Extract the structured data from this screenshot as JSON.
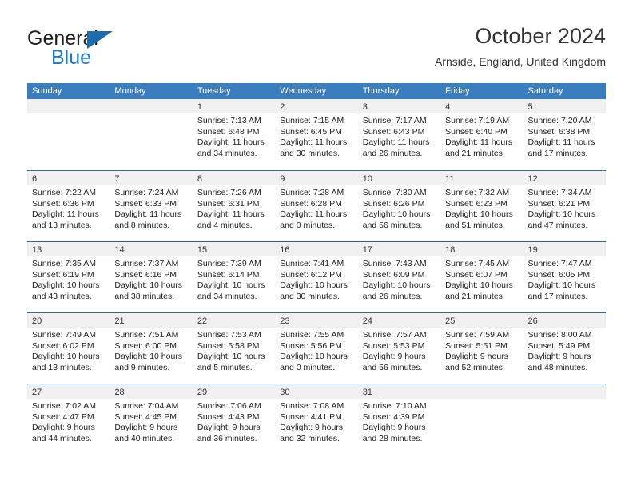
{
  "brand": {
    "name_top": "General",
    "name_bottom": "Blue",
    "accent_color": "#1b7cc4",
    "triangle_color": "#1b6cb0"
  },
  "header": {
    "title": "October 2024",
    "subtitle": "Arnside, England, United Kingdom"
  },
  "theme": {
    "header_row_bg": "#3b7ec0",
    "row_divider": "#2f6ca8",
    "day_band_bg": "#f0f0f0"
  },
  "weekdays": [
    "Sunday",
    "Monday",
    "Tuesday",
    "Wednesday",
    "Thursday",
    "Friday",
    "Saturday"
  ],
  "weeks": [
    [
      {
        "day": "",
        "sunrise": "",
        "sunset": "",
        "daylight1": "",
        "daylight2": ""
      },
      {
        "day": "",
        "sunrise": "",
        "sunset": "",
        "daylight1": "",
        "daylight2": ""
      },
      {
        "day": "1",
        "sunrise": "Sunrise: 7:13 AM",
        "sunset": "Sunset: 6:48 PM",
        "daylight1": "Daylight: 11 hours",
        "daylight2": "and 34 minutes."
      },
      {
        "day": "2",
        "sunrise": "Sunrise: 7:15 AM",
        "sunset": "Sunset: 6:45 PM",
        "daylight1": "Daylight: 11 hours",
        "daylight2": "and 30 minutes."
      },
      {
        "day": "3",
        "sunrise": "Sunrise: 7:17 AM",
        "sunset": "Sunset: 6:43 PM",
        "daylight1": "Daylight: 11 hours",
        "daylight2": "and 26 minutes."
      },
      {
        "day": "4",
        "sunrise": "Sunrise: 7:19 AM",
        "sunset": "Sunset: 6:40 PM",
        "daylight1": "Daylight: 11 hours",
        "daylight2": "and 21 minutes."
      },
      {
        "day": "5",
        "sunrise": "Sunrise: 7:20 AM",
        "sunset": "Sunset: 6:38 PM",
        "daylight1": "Daylight: 11 hours",
        "daylight2": "and 17 minutes."
      }
    ],
    [
      {
        "day": "6",
        "sunrise": "Sunrise: 7:22 AM",
        "sunset": "Sunset: 6:36 PM",
        "daylight1": "Daylight: 11 hours",
        "daylight2": "and 13 minutes."
      },
      {
        "day": "7",
        "sunrise": "Sunrise: 7:24 AM",
        "sunset": "Sunset: 6:33 PM",
        "daylight1": "Daylight: 11 hours",
        "daylight2": "and 8 minutes."
      },
      {
        "day": "8",
        "sunrise": "Sunrise: 7:26 AM",
        "sunset": "Sunset: 6:31 PM",
        "daylight1": "Daylight: 11 hours",
        "daylight2": "and 4 minutes."
      },
      {
        "day": "9",
        "sunrise": "Sunrise: 7:28 AM",
        "sunset": "Sunset: 6:28 PM",
        "daylight1": "Daylight: 11 hours",
        "daylight2": "and 0 minutes."
      },
      {
        "day": "10",
        "sunrise": "Sunrise: 7:30 AM",
        "sunset": "Sunset: 6:26 PM",
        "daylight1": "Daylight: 10 hours",
        "daylight2": "and 56 minutes."
      },
      {
        "day": "11",
        "sunrise": "Sunrise: 7:32 AM",
        "sunset": "Sunset: 6:23 PM",
        "daylight1": "Daylight: 10 hours",
        "daylight2": "and 51 minutes."
      },
      {
        "day": "12",
        "sunrise": "Sunrise: 7:34 AM",
        "sunset": "Sunset: 6:21 PM",
        "daylight1": "Daylight: 10 hours",
        "daylight2": "and 47 minutes."
      }
    ],
    [
      {
        "day": "13",
        "sunrise": "Sunrise: 7:35 AM",
        "sunset": "Sunset: 6:19 PM",
        "daylight1": "Daylight: 10 hours",
        "daylight2": "and 43 minutes."
      },
      {
        "day": "14",
        "sunrise": "Sunrise: 7:37 AM",
        "sunset": "Sunset: 6:16 PM",
        "daylight1": "Daylight: 10 hours",
        "daylight2": "and 38 minutes."
      },
      {
        "day": "15",
        "sunrise": "Sunrise: 7:39 AM",
        "sunset": "Sunset: 6:14 PM",
        "daylight1": "Daylight: 10 hours",
        "daylight2": "and 34 minutes."
      },
      {
        "day": "16",
        "sunrise": "Sunrise: 7:41 AM",
        "sunset": "Sunset: 6:12 PM",
        "daylight1": "Daylight: 10 hours",
        "daylight2": "and 30 minutes."
      },
      {
        "day": "17",
        "sunrise": "Sunrise: 7:43 AM",
        "sunset": "Sunset: 6:09 PM",
        "daylight1": "Daylight: 10 hours",
        "daylight2": "and 26 minutes."
      },
      {
        "day": "18",
        "sunrise": "Sunrise: 7:45 AM",
        "sunset": "Sunset: 6:07 PM",
        "daylight1": "Daylight: 10 hours",
        "daylight2": "and 21 minutes."
      },
      {
        "day": "19",
        "sunrise": "Sunrise: 7:47 AM",
        "sunset": "Sunset: 6:05 PM",
        "daylight1": "Daylight: 10 hours",
        "daylight2": "and 17 minutes."
      }
    ],
    [
      {
        "day": "20",
        "sunrise": "Sunrise: 7:49 AM",
        "sunset": "Sunset: 6:02 PM",
        "daylight1": "Daylight: 10 hours",
        "daylight2": "and 13 minutes."
      },
      {
        "day": "21",
        "sunrise": "Sunrise: 7:51 AM",
        "sunset": "Sunset: 6:00 PM",
        "daylight1": "Daylight: 10 hours",
        "daylight2": "and 9 minutes."
      },
      {
        "day": "22",
        "sunrise": "Sunrise: 7:53 AM",
        "sunset": "Sunset: 5:58 PM",
        "daylight1": "Daylight: 10 hours",
        "daylight2": "and 5 minutes."
      },
      {
        "day": "23",
        "sunrise": "Sunrise: 7:55 AM",
        "sunset": "Sunset: 5:56 PM",
        "daylight1": "Daylight: 10 hours",
        "daylight2": "and 0 minutes."
      },
      {
        "day": "24",
        "sunrise": "Sunrise: 7:57 AM",
        "sunset": "Sunset: 5:53 PM",
        "daylight1": "Daylight: 9 hours",
        "daylight2": "and 56 minutes."
      },
      {
        "day": "25",
        "sunrise": "Sunrise: 7:59 AM",
        "sunset": "Sunset: 5:51 PM",
        "daylight1": "Daylight: 9 hours",
        "daylight2": "and 52 minutes."
      },
      {
        "day": "26",
        "sunrise": "Sunrise: 8:00 AM",
        "sunset": "Sunset: 5:49 PM",
        "daylight1": "Daylight: 9 hours",
        "daylight2": "and 48 minutes."
      }
    ],
    [
      {
        "day": "27",
        "sunrise": "Sunrise: 7:02 AM",
        "sunset": "Sunset: 4:47 PM",
        "daylight1": "Daylight: 9 hours",
        "daylight2": "and 44 minutes."
      },
      {
        "day": "28",
        "sunrise": "Sunrise: 7:04 AM",
        "sunset": "Sunset: 4:45 PM",
        "daylight1": "Daylight: 9 hours",
        "daylight2": "and 40 minutes."
      },
      {
        "day": "29",
        "sunrise": "Sunrise: 7:06 AM",
        "sunset": "Sunset: 4:43 PM",
        "daylight1": "Daylight: 9 hours",
        "daylight2": "and 36 minutes."
      },
      {
        "day": "30",
        "sunrise": "Sunrise: 7:08 AM",
        "sunset": "Sunset: 4:41 PM",
        "daylight1": "Daylight: 9 hours",
        "daylight2": "and 32 minutes."
      },
      {
        "day": "31",
        "sunrise": "Sunrise: 7:10 AM",
        "sunset": "Sunset: 4:39 PM",
        "daylight1": "Daylight: 9 hours",
        "daylight2": "and 28 minutes."
      },
      {
        "day": "",
        "sunrise": "",
        "sunset": "",
        "daylight1": "",
        "daylight2": ""
      },
      {
        "day": "",
        "sunrise": "",
        "sunset": "",
        "daylight1": "",
        "daylight2": ""
      }
    ]
  ]
}
